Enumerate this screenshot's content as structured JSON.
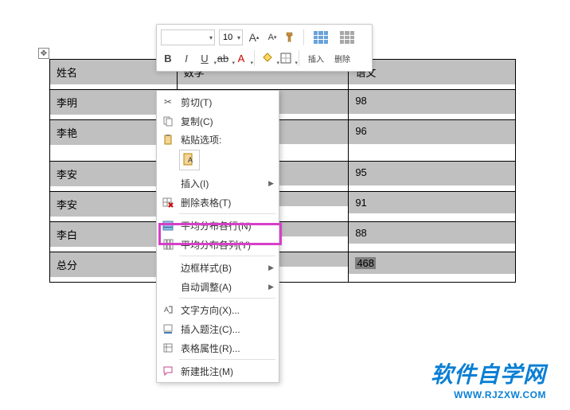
{
  "mini_toolbar": {
    "font_name": "",
    "font_size": "10",
    "grow_font": "A",
    "shrink_font": "A",
    "bold": "B",
    "italic": "I",
    "underline": "U",
    "insert_label": "插入",
    "delete_label": "删除"
  },
  "context_menu": {
    "cut": "剪切(T)",
    "copy": "复制(C)",
    "paste_options": "粘贴选项:",
    "paste_keep_text": "A",
    "insert": "插入(I)",
    "delete_table": "删除表格(T)",
    "distribute_rows": "平均分布各行(N)",
    "distribute_cols": "平均分布各列(Y)",
    "border_styles": "边框样式(B)",
    "autofit": "自动调整(A)",
    "text_direction": "文字方向(X)...",
    "insert_caption": "插入题注(C)...",
    "table_props": "表格属性(R)...",
    "new_comment": "新建批注(M)"
  },
  "table": {
    "headers": {
      "c0": "姓名",
      "c1": "数学",
      "c2": "语文"
    },
    "rows": [
      {
        "name": "李明",
        "chinese": "98"
      },
      {
        "name": "李艳",
        "chinese": "96"
      },
      {
        "name": "李安",
        "chinese": "95"
      },
      {
        "name": "李安",
        "chinese": "91"
      },
      {
        "name": "李白",
        "chinese": "88"
      },
      {
        "name": "总分",
        "chinese": "468"
      }
    ]
  },
  "watermark": {
    "title": "软件自学网",
    "url": "WWW.RJZXW.COM"
  }
}
